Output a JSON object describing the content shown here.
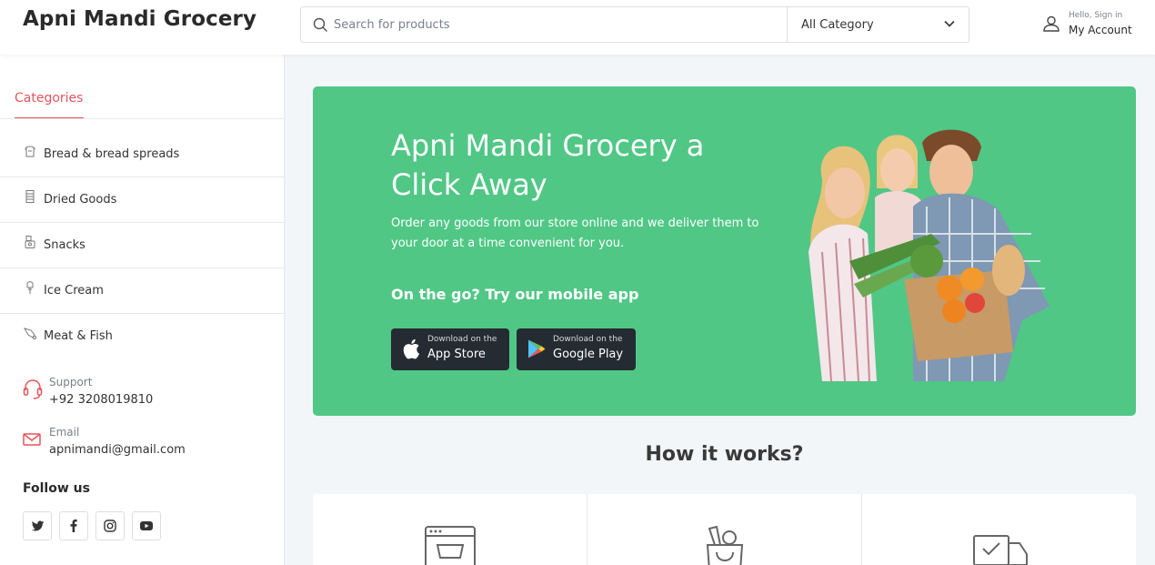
{
  "header": {
    "brand": "Apni Mandi Grocery",
    "search": {
      "placeholder": "Search for products",
      "icon": "search-icon"
    },
    "category_select": {
      "selected": "All Category"
    },
    "account": {
      "greeting": "Hello, Sign in",
      "label": "My Account",
      "icon": "user-icon"
    }
  },
  "sidebar": {
    "title": "Categories",
    "items": [
      {
        "label": "Bread & bread spreads",
        "icon": "bread-icon"
      },
      {
        "label": "Dried Goods",
        "icon": "dried-goods-icon"
      },
      {
        "label": "Snacks",
        "icon": "snacks-icon"
      },
      {
        "label": "Ice Cream",
        "icon": "ice-cream-icon"
      },
      {
        "label": "Meat & Fish",
        "icon": "meat-fish-icon"
      }
    ],
    "support": {
      "label": "Support",
      "value": "+92 3208019810",
      "icon": "headset-icon"
    },
    "email": {
      "label": "Email",
      "value": "apnimandi@gmail.com",
      "icon": "mail-icon"
    },
    "follow_title": "Follow us",
    "socials": [
      "twitter-icon",
      "facebook-icon",
      "instagram-icon",
      "youtube-icon"
    ]
  },
  "hero": {
    "title": "Apni Mandi Grocery a Click Away",
    "description": "Order any goods from our store online and we deliver them to your door at a time convenient for you.",
    "subtitle": "On the go? Try our mobile app",
    "app_store": {
      "small": "Download on the",
      "big": "App Store",
      "icon": "apple-icon"
    },
    "google_play": {
      "small": "Download on the",
      "big": "Google Play",
      "icon": "google-play-icon"
    },
    "background_color": "#50c785"
  },
  "how_it_works": {
    "title": "How it works?",
    "steps": [
      {
        "icon": "online-cart-icon"
      },
      {
        "icon": "grocery-bag-icon"
      },
      {
        "icon": "delivery-truck-icon"
      }
    ]
  },
  "colors": {
    "accent": "#e8535b",
    "hero": "#50c785",
    "dark_button": "#252b33"
  }
}
